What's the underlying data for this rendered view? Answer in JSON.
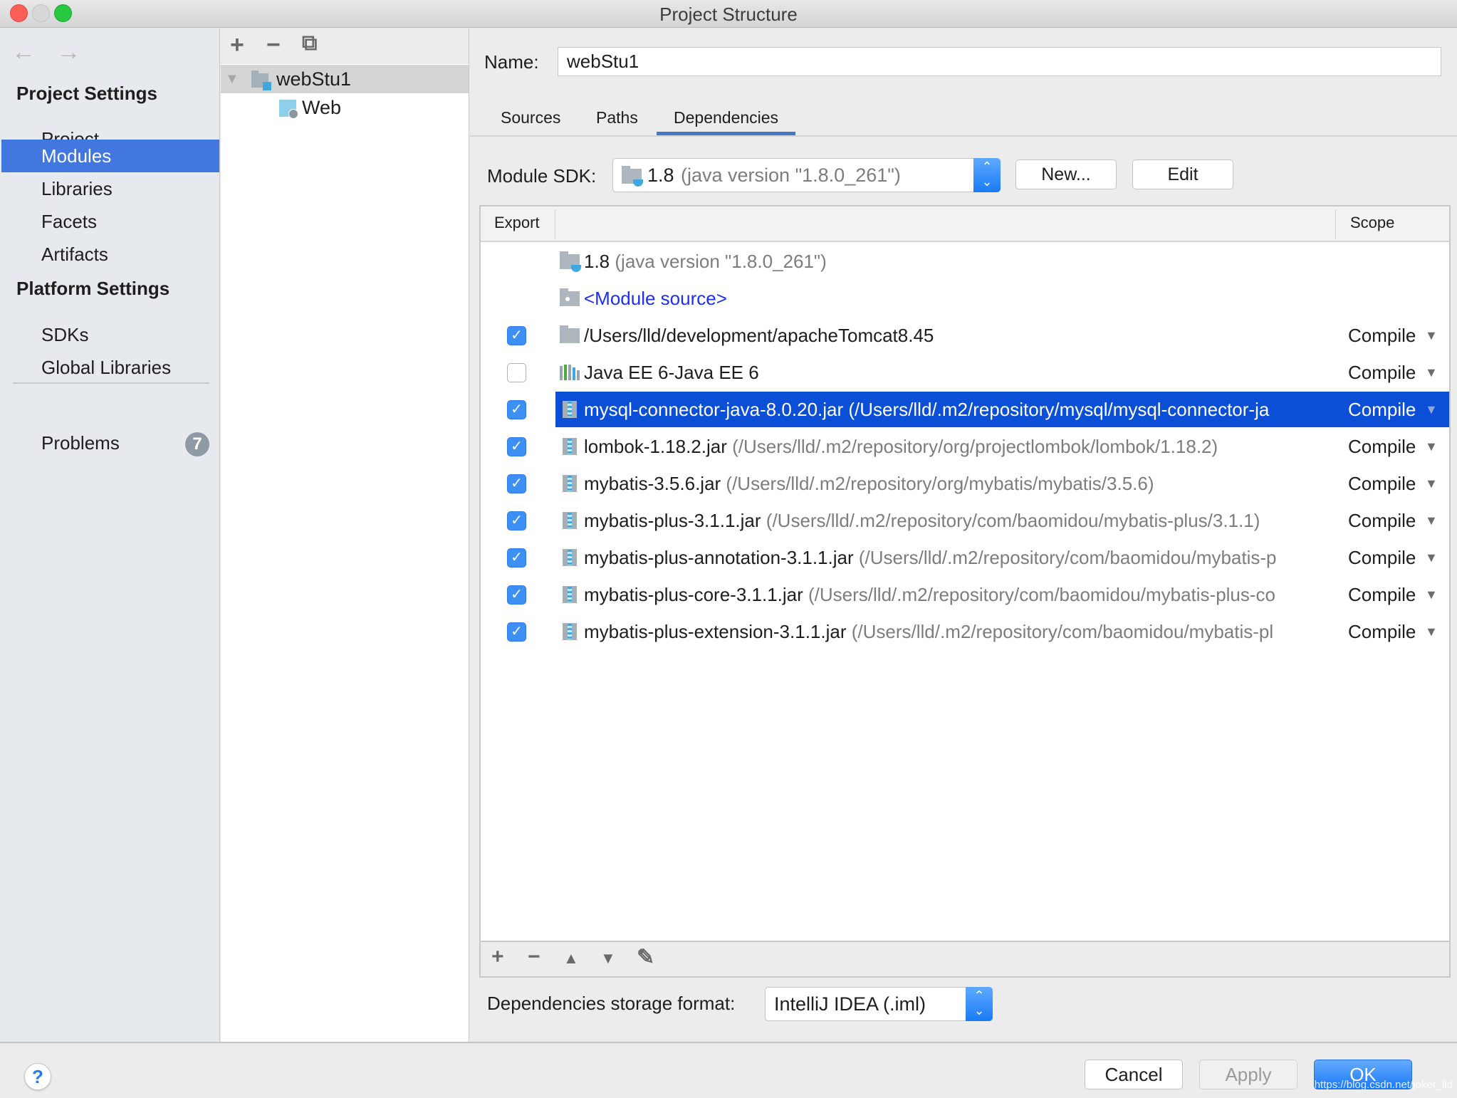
{
  "window": {
    "title": "Project Structure"
  },
  "nav": {
    "back": "←",
    "forward": "→"
  },
  "sidebar": {
    "project_settings_header": "Project Settings",
    "platform_settings_header": "Platform Settings",
    "items": [
      {
        "label": "Project",
        "selected": false
      },
      {
        "label": "Modules",
        "selected": true
      },
      {
        "label": "Libraries",
        "selected": false
      },
      {
        "label": "Facets",
        "selected": false
      },
      {
        "label": "Artifacts",
        "selected": false
      },
      {
        "label": "SDKs",
        "selected": false
      },
      {
        "label": "Global Libraries",
        "selected": false
      }
    ],
    "problems": {
      "label": "Problems",
      "count": "7"
    }
  },
  "module_tree": {
    "toolbar": {
      "add": "+",
      "remove": "−",
      "copy": "⧉"
    },
    "nodes": [
      {
        "label": "webStu1",
        "expanded": true,
        "selected": true
      },
      {
        "label": "Web",
        "selected": false
      }
    ]
  },
  "module": {
    "name_label": "Name:",
    "name_value": "webStu1",
    "tabs": [
      {
        "label": "Sources",
        "active": false
      },
      {
        "label": "Paths",
        "active": false
      },
      {
        "label": "Dependencies",
        "active": true
      }
    ],
    "sdk_label": "Module SDK:",
    "sdk_value": "1.8",
    "sdk_detail": "(java version \"1.8.0_261\")",
    "new_button": "New...",
    "edit_button": "Edit"
  },
  "dependencies": {
    "columns": {
      "export": "Export",
      "scope": "Scope"
    },
    "rows": [
      {
        "icon": "jdk-icon",
        "name": "1.8",
        "detail": "(java version \"1.8.0_261\")",
        "checkbox": null,
        "scope": ""
      },
      {
        "icon": "module-source-icon",
        "name": "<Module source>",
        "detail": "",
        "checkbox": null,
        "scope": "",
        "link": true
      },
      {
        "icon": "folder-icon",
        "name": "/Users/lld/development/apacheTomcat8.45",
        "detail": "",
        "checkbox": true,
        "scope": "Compile"
      },
      {
        "icon": "library-icon",
        "name": "Java EE 6-Java EE 6",
        "detail": "",
        "checkbox": false,
        "scope": "Compile"
      },
      {
        "icon": "jar-icon",
        "name": "mysql-connector-java-8.0.20.jar",
        "detail": "(/Users/lld/.m2/repository/mysql/mysql-connector-ja",
        "checkbox": true,
        "scope": "Compile",
        "selected": true
      },
      {
        "icon": "jar-icon",
        "name": "lombok-1.18.2.jar",
        "detail": "(/Users/lld/.m2/repository/org/projectlombok/lombok/1.18.2)",
        "checkbox": true,
        "scope": "Compile"
      },
      {
        "icon": "jar-icon",
        "name": "mybatis-3.5.6.jar",
        "detail": "(/Users/lld/.m2/repository/org/mybatis/mybatis/3.5.6)",
        "checkbox": true,
        "scope": "Compile"
      },
      {
        "icon": "jar-icon",
        "name": "mybatis-plus-3.1.1.jar",
        "detail": "(/Users/lld/.m2/repository/com/baomidou/mybatis-plus/3.1.1)",
        "checkbox": true,
        "scope": "Compile"
      },
      {
        "icon": "jar-icon",
        "name": "mybatis-plus-annotation-3.1.1.jar",
        "detail": "(/Users/lld/.m2/repository/com/baomidou/mybatis-p",
        "checkbox": true,
        "scope": "Compile"
      },
      {
        "icon": "jar-icon",
        "name": "mybatis-plus-core-3.1.1.jar",
        "detail": "(/Users/lld/.m2/repository/com/baomidou/mybatis-plus-co",
        "checkbox": true,
        "scope": "Compile"
      },
      {
        "icon": "jar-icon",
        "name": "mybatis-plus-extension-3.1.1.jar",
        "detail": "(/Users/lld/.m2/repository/com/baomidou/mybatis-pl",
        "checkbox": true,
        "scope": "Compile"
      }
    ],
    "toolbar": {
      "add": "+",
      "remove": "−",
      "up": "▲",
      "down": "▼",
      "edit": "✎"
    },
    "storage_label": "Dependencies storage format:",
    "storage_value": "IntelliJ IDEA (.iml)"
  },
  "footer": {
    "help": "?",
    "cancel": "Cancel",
    "apply": "Apply",
    "ok": "OK",
    "watermark": "https://blog.csdn.net/joker_lld"
  },
  "colors": {
    "selection": "#4377e0",
    "table_selection": "#0a4fd6",
    "accent": "#1b7af6",
    "link": "#1d2ff0"
  }
}
